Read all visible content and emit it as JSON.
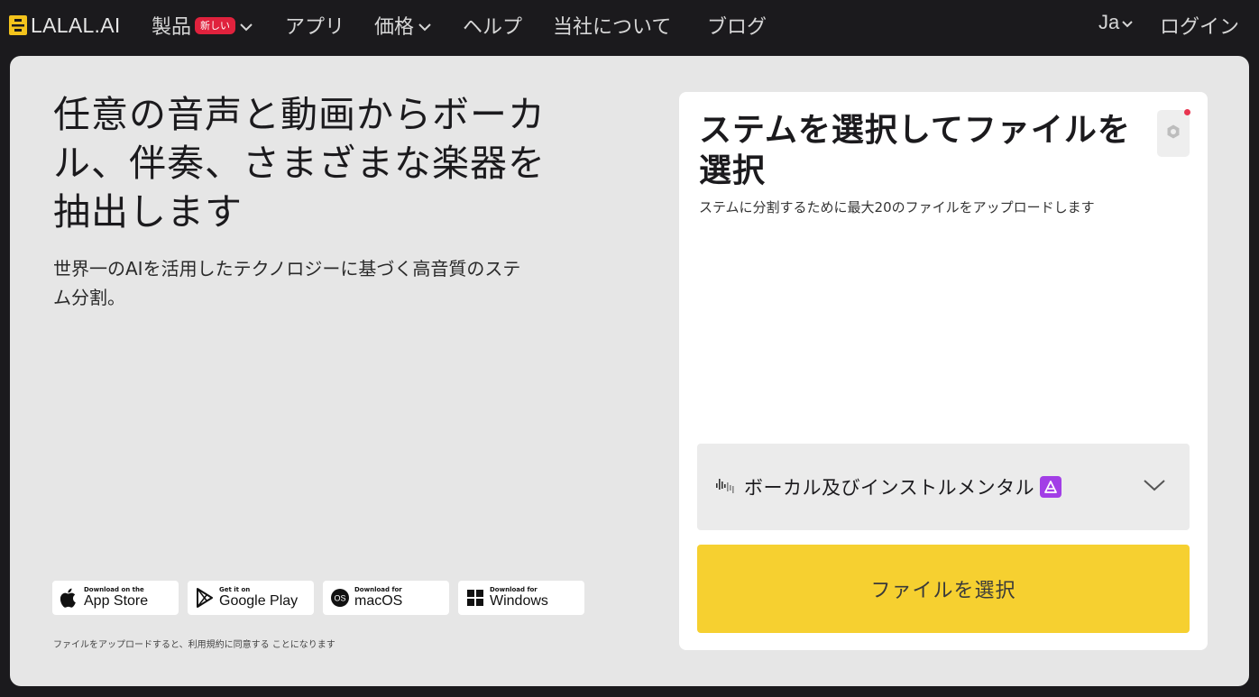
{
  "nav": {
    "logo_text": "LALAL.AI",
    "items": [
      {
        "label": "製品",
        "badge": "新しい",
        "has_chevron": true
      },
      {
        "label": "アプリ"
      },
      {
        "label": "価格",
        "has_chevron": true
      },
      {
        "label": "ヘルプ"
      },
      {
        "label": "当社について"
      },
      {
        "label": "ブログ"
      }
    ],
    "language": "Ja",
    "login": "ログイン"
  },
  "hero": {
    "title": "任意の音声と動画からボーカル、伴奏、さまざまな楽器を抽出します",
    "subtitle": "世界一のAIを活用したテクノロジーに基づく高音質のステム分割。"
  },
  "stores": [
    {
      "small": "Download on the",
      "big": "App Store",
      "icon": "apple-icon"
    },
    {
      "small": "Get it on",
      "big": "Google Play",
      "icon": "google-play-icon"
    },
    {
      "small": "Download for",
      "big": "macOS",
      "icon": "macos-icon"
    },
    {
      "small": "Download for",
      "big": "Windows",
      "icon": "windows-icon"
    }
  ],
  "terms": "ファイルをアップロードすると、利用規約に同意する ことになります",
  "upload_card": {
    "title": "ステムを選択してファイルを選択",
    "description": "ステムに分割するために最大20のファイルをアップロードします",
    "stem_select": {
      "value": "ボーカル及びインストルメンタル",
      "icon": "waveform-icon"
    },
    "button": "ファイルを選択"
  },
  "colors": {
    "background": "#1b1a1d",
    "panel": "#e6e6e6",
    "accent_yellow": "#f6d030",
    "badge_red": "#e0223d",
    "stem_badge_purple": "#a23ee6",
    "logo_yellow": "#f3c31c"
  }
}
